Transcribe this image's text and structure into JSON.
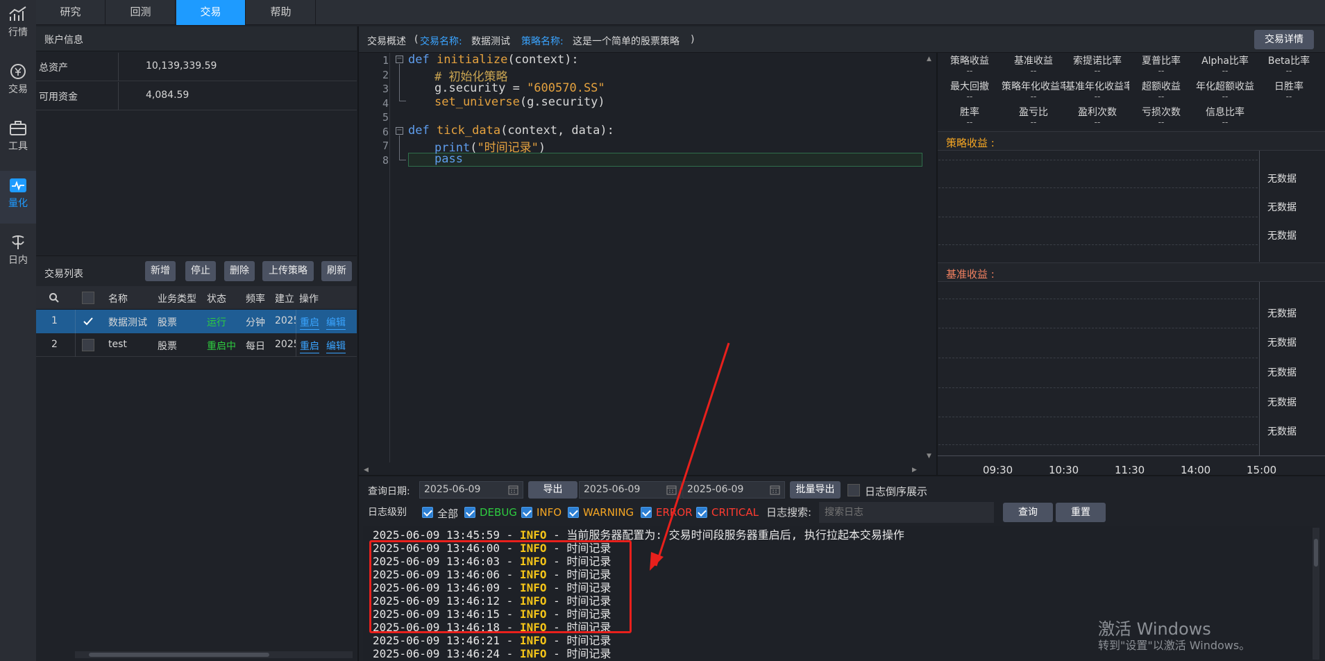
{
  "leftnav": {
    "items": [
      {
        "label": "行情",
        "icon": "chart-icon"
      },
      {
        "label": "交易",
        "icon": "yen-icon"
      },
      {
        "label": "工具",
        "icon": "toolbox-icon"
      },
      {
        "label": "量化",
        "icon": "pulse-icon"
      },
      {
        "label": "日内",
        "icon": "intraday-icon"
      }
    ]
  },
  "topbar": {
    "tabs": [
      "研究",
      "回测",
      "交易",
      "帮助"
    ]
  },
  "account": {
    "title": "账户信息",
    "rows": [
      {
        "label": "总资产",
        "value": "10,139,339.59"
      },
      {
        "label": "可用资金",
        "value": "4,084.59"
      }
    ]
  },
  "tradelist": {
    "title": "交易列表",
    "buttons": [
      "新增",
      "停止",
      "删除",
      "上传策略",
      "刷新"
    ],
    "headers": [
      "名称",
      "业务类型",
      "状态",
      "频率",
      "建立",
      "操作"
    ],
    "rows": [
      {
        "idx": "1",
        "name": "数据测试",
        "type": "股票",
        "status": "运行",
        "freq": "分钟",
        "created": "2025",
        "op1": "重启",
        "op2": "编辑"
      },
      {
        "idx": "2",
        "name": "test",
        "type": "股票",
        "status": "重启中",
        "freq": "每日",
        "created": "2025",
        "op1": "重启",
        "op2": "编辑"
      }
    ]
  },
  "overview": {
    "prefix": "交易概述",
    "trade_label": "交易名称:",
    "trade_name": "数据测试",
    "strategy_label": "策略名称:",
    "strategy_name": "这是一个简单的股票策略",
    "open_paren": "(",
    "close_paren": ")",
    "detail_button": "交易详情"
  },
  "code": {
    "line_numbers": [
      "1",
      "2",
      "3",
      "4",
      "5",
      "6",
      "7",
      "8"
    ],
    "l1a": "def ",
    "l1b": "initialize",
    "l1c": "(context):",
    "l2": "# 初始化策略",
    "l3a": "g.security = ",
    "l3b": "\"600570.SS\"",
    "l4a": "set_universe",
    "l4b": "(g.security)",
    "l6a": "def ",
    "l6b": "tick_data",
    "l6c": "(context, data):",
    "l7a": "print",
    "l7b": "(",
    "l7c": "\"时间记录\"",
    "l7d": ")",
    "l8": "pass"
  },
  "metrics": {
    "labels": [
      "策略收益",
      "基准收益",
      "索提诺比率",
      "夏普比率",
      "Alpha比率",
      "Beta比率",
      "最大回撤",
      "策略年化收益率",
      "基准年化收益率",
      "超额收益",
      "年化超额收益",
      "日胜率",
      "胜率",
      "盈亏比",
      "盈利次数",
      "亏损次数",
      "信息比率"
    ],
    "placeholder": "--"
  },
  "chart1": {
    "title": "策略收益 :",
    "nodata": [
      "无数据",
      "无数据",
      "无数据"
    ]
  },
  "chart2": {
    "title": "基准收益 :",
    "nodata": [
      "无数据",
      "无数据",
      "无数据",
      "无数据",
      "无数据"
    ],
    "x_ticks": [
      "09:30",
      "10:30",
      "11:30",
      "14:00",
      "15:00"
    ]
  },
  "query": {
    "date_label": "查询日期:",
    "date1": "2025-06-09",
    "export": "导出",
    "date2": "2025-06-09",
    "date3": "2025-06-09",
    "batch_export": "批量导出",
    "reverse_label": "日志倒序展示",
    "level_label": "日志级别",
    "levels": [
      "全部",
      "DEBUG",
      "INFO",
      "WARNING",
      "ERROR",
      "CRITICAL"
    ],
    "level_colors": [
      "#d8d8d8",
      "#2ecc40",
      "#f5a623",
      "#f5a623",
      "#ff3b30",
      "#ff3b30"
    ],
    "search_label": "日志搜索:",
    "search_placeholder": "搜索日志",
    "query_button": "查询",
    "reset_button": "重置"
  },
  "logs": [
    {
      "time": "2025-06-09 13:45:59",
      "level": "INFO",
      "msg": "当前服务器配置为: 交易时间段服务器重启后, 执行拉起本交易操作"
    },
    {
      "time": "2025-06-09 13:46:00",
      "level": "INFO",
      "msg": "时间记录"
    },
    {
      "time": "2025-06-09 13:46:03",
      "level": "INFO",
      "msg": "时间记录"
    },
    {
      "time": "2025-06-09 13:46:06",
      "level": "INFO",
      "msg": "时间记录"
    },
    {
      "time": "2025-06-09 13:46:09",
      "level": "INFO",
      "msg": "时间记录"
    },
    {
      "time": "2025-06-09 13:46:12",
      "level": "INFO",
      "msg": "时间记录"
    },
    {
      "time": "2025-06-09 13:46:15",
      "level": "INFO",
      "msg": "时间记录"
    },
    {
      "time": "2025-06-09 13:46:18",
      "level": "INFO",
      "msg": "时间记录"
    },
    {
      "time": "2025-06-09 13:46:21",
      "level": "INFO",
      "msg": "时间记录"
    },
    {
      "time": "2025-06-09 13:46:24",
      "level": "INFO",
      "msg": "时间记录"
    }
  ],
  "log_sep": " - ",
  "watermark": {
    "line1": "激活 Windows",
    "line2": "转到\"设置\"以激活 Windows。"
  },
  "colors": {
    "accent": "#1e9bff",
    "running": "#2ecc40",
    "annotation": "#e8201c"
  }
}
